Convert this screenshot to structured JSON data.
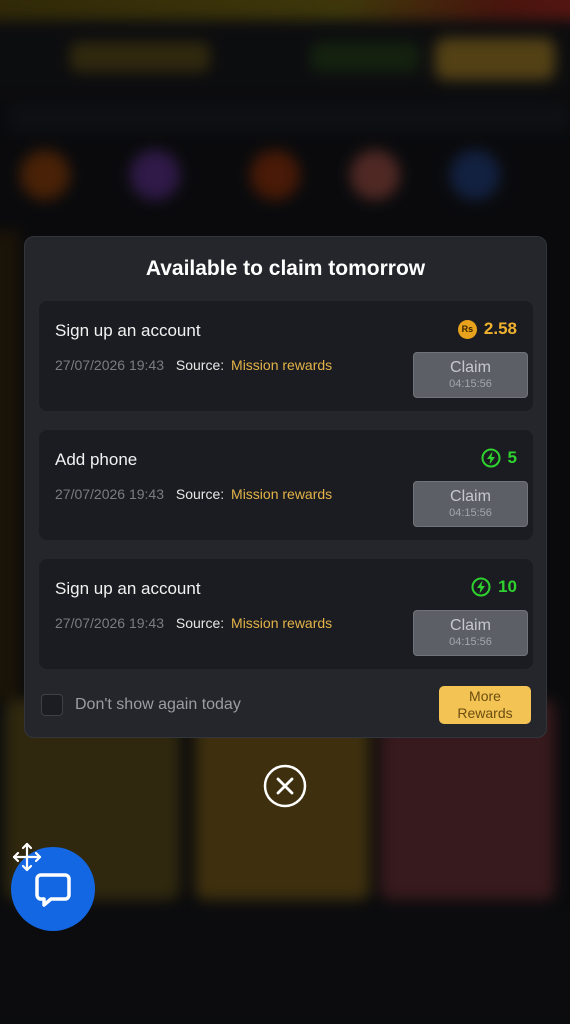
{
  "modal": {
    "title": "Available to claim tomorrow",
    "rewards": [
      {
        "title": "Sign up an account",
        "date": "27/07/2026 19:43",
        "source_label": "Source:",
        "source_value": "Mission rewards",
        "reward_icon": "rupee-coin-icon",
        "reward_amount": "2.58",
        "claim_label": "Claim",
        "claim_timer": "04:15:56"
      },
      {
        "title": "Add phone",
        "date": "27/07/2026 19:43",
        "source_label": "Source:",
        "source_value": "Mission rewards",
        "reward_icon": "lightning-icon",
        "reward_amount": "5",
        "claim_label": "Claim",
        "claim_timer": "04:15:56"
      },
      {
        "title": "Sign up an account",
        "date": "27/07/2026 19:43",
        "source_label": "Source:",
        "source_value": "Mission rewards",
        "reward_icon": "lightning-icon",
        "reward_amount": "10",
        "claim_label": "Claim",
        "claim_timer": "04:15:56"
      }
    ],
    "coin_symbol": "Rs",
    "dont_show_label": "Don't show again today",
    "more_rewards_line1": "More",
    "more_rewards_line2": "Rewards"
  },
  "colors": {
    "accent_gold": "#f3c453",
    "source_text": "#e3b348",
    "energy_green": "#2fd12f",
    "chat_blue": "#1467e3"
  }
}
